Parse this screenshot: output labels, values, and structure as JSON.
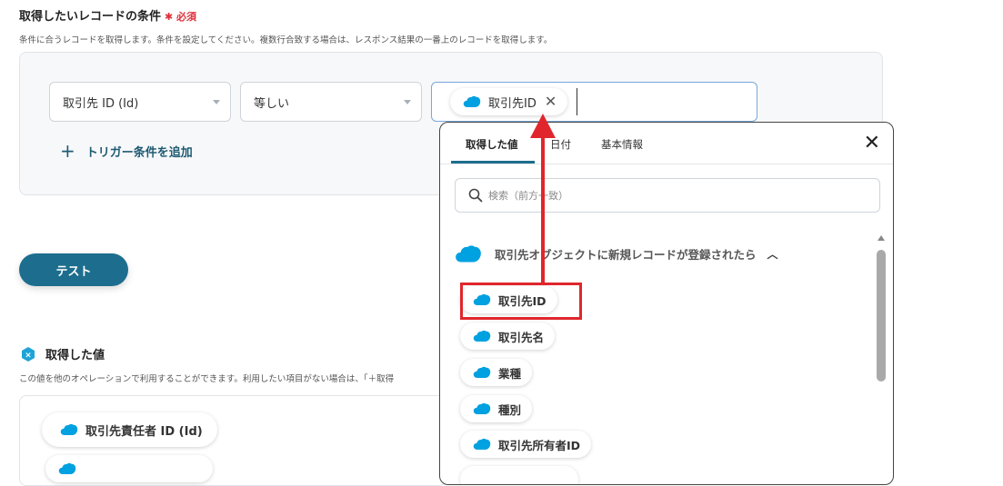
{
  "condition_section": {
    "title": "取得したいレコードの条件",
    "required_mark": "✱ 必須",
    "description": "条件に合うレコードを取得します。条件を設定してください。複数行合致する場合は、レスポンス結果の一番上のレコードを取得します。",
    "field_select": "取引先 ID (Id)",
    "operator_select": "等しい",
    "value_chip": "取引先ID",
    "add_trigger": "トリガー条件を追加"
  },
  "test_button": "テスト",
  "values_section": {
    "title": "取得した値",
    "description": "この値を他のオペレーションで利用することができます。利用したい項目がない場合は、「＋取得",
    "chips": [
      "取引先責任者 ID (Id)",
      ""
    ]
  },
  "dropdown": {
    "tabs": [
      "取得した値",
      "日付",
      "基本情報"
    ],
    "active_tab": "取得した値",
    "search_placeholder": "検索（前方一致）",
    "group_label": "取引先オブジェクトに新規レコードが登録されたら",
    "options": [
      "取引先ID",
      "取引先名",
      "業種",
      "種別",
      "取引先所有者ID",
      ""
    ]
  },
  "colors": {
    "accent": "#1d6e8e",
    "highlight": "#e0262c",
    "salesforce": "#00a1e0",
    "required": "#e0303a"
  },
  "icons": {
    "salesforce": "salesforce-cloud-icon",
    "close": "close-icon",
    "search": "search-icon",
    "chevron": "chevron-up-icon",
    "plus": "plus-icon"
  }
}
